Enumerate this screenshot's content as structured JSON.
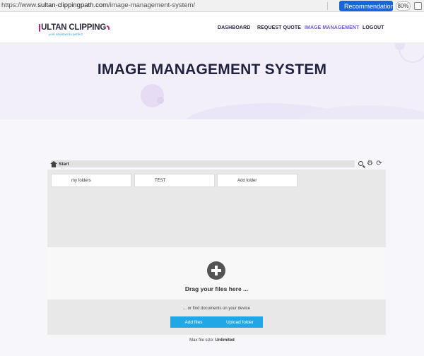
{
  "browser": {
    "url_prefix": "https://www.",
    "url_host": "sultan-clippingpath.com",
    "url_path": "/image-management-system/",
    "recommendation_label": "Recommendation",
    "zoom": "80%"
  },
  "header": {
    "logo_text": "ULTAN CLIPPING",
    "logo_tagline": "your assistant to perfect",
    "nav": [
      {
        "label": "DASHBOARD"
      },
      {
        "label": "REQUEST QUOTE"
      },
      {
        "label": "IMAGE MANAGEMENT"
      },
      {
        "label": "LOGOUT"
      }
    ],
    "active_nav": "IMAGE MANAGEMENT"
  },
  "hero": {
    "title": "IMAGE MANAGEMENT SYSTEM"
  },
  "file_manager": {
    "breadcrumb": "Start",
    "folders": [
      {
        "label": "my folders"
      },
      {
        "label": "TEST"
      },
      {
        "label": "Add folder"
      }
    ],
    "drag_text": "Drag your files here ...",
    "find_text": "... or find documents on your device",
    "add_files_label": "Add files",
    "upload_folder_label": "Upload folder",
    "max_size_label": "Max file size:",
    "max_size_value": "Unlimited"
  },
  "colors": {
    "accent": "#22a7e6",
    "nav_active": "#6c5ad6",
    "brand": "#d21e6c",
    "recommendation": "#1a66d4"
  }
}
